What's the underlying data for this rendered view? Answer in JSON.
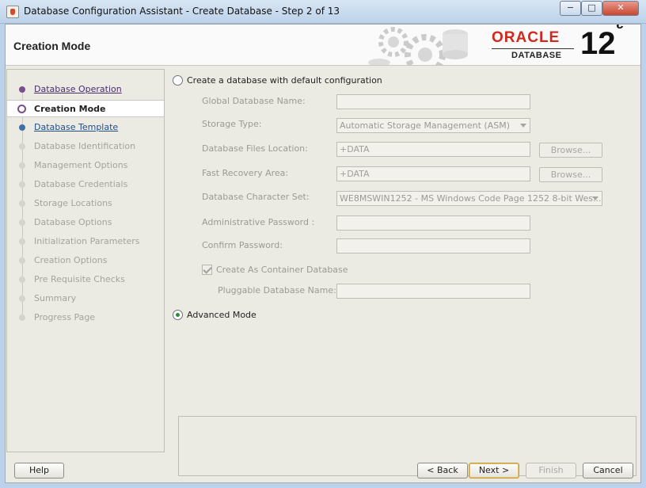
{
  "window": {
    "title": "Database Configuration Assistant - Create Database - Step 2 of 13",
    "min_symbol": "−",
    "max_symbol": "□",
    "close_symbol": "✕"
  },
  "header": {
    "page_title": "Creation Mode",
    "logo_brand": "ORACLE",
    "logo_product": "DATABASE",
    "version_number": "12",
    "version_suffix": "c"
  },
  "steps": [
    {
      "label": "Database Operation",
      "state": "done"
    },
    {
      "label": "Creation Mode",
      "state": "current"
    },
    {
      "label": "Database Template",
      "state": "next"
    },
    {
      "label": "Database Identification",
      "state": "pending"
    },
    {
      "label": "Management Options",
      "state": "pending"
    },
    {
      "label": "Database Credentials",
      "state": "pending"
    },
    {
      "label": "Storage Locations",
      "state": "pending"
    },
    {
      "label": "Database Options",
      "state": "pending"
    },
    {
      "label": "Initialization Parameters",
      "state": "pending"
    },
    {
      "label": "Creation Options",
      "state": "pending"
    },
    {
      "label": "Pre Requisite Checks",
      "state": "pending"
    },
    {
      "label": "Summary",
      "state": "pending"
    },
    {
      "label": "Progress Page",
      "state": "pending"
    }
  ],
  "form": {
    "default_config_label": "Create a database with default configuration",
    "default_config_selected": false,
    "global_db_name_label": "Global Database Name:",
    "global_db_name_value": "",
    "storage_type_label": "Storage Type:",
    "storage_type_value": "Automatic Storage Management (ASM)",
    "db_files_location_label": "Database Files Location:",
    "db_files_location_value": "+DATA",
    "fast_recovery_label": "Fast Recovery Area:",
    "fast_recovery_value": "+DATA",
    "browse_label": "Browse...",
    "charset_label": "Database Character Set:",
    "charset_value": "WE8MSWIN1252 - MS Windows Code Page 1252 8-bit Wes...",
    "admin_password_label": "Administrative Password :",
    "confirm_password_label": "Confirm Password:",
    "container_db_label": "Create As Container Database",
    "container_db_checked": true,
    "pluggable_db_label": "Pluggable Database Name:",
    "pluggable_db_value": "",
    "advanced_mode_label": "Advanced Mode",
    "advanced_mode_selected": true
  },
  "footer": {
    "help": "Help",
    "back": "< Back",
    "next": "Next >",
    "finish": "Finish",
    "cancel": "Cancel"
  }
}
